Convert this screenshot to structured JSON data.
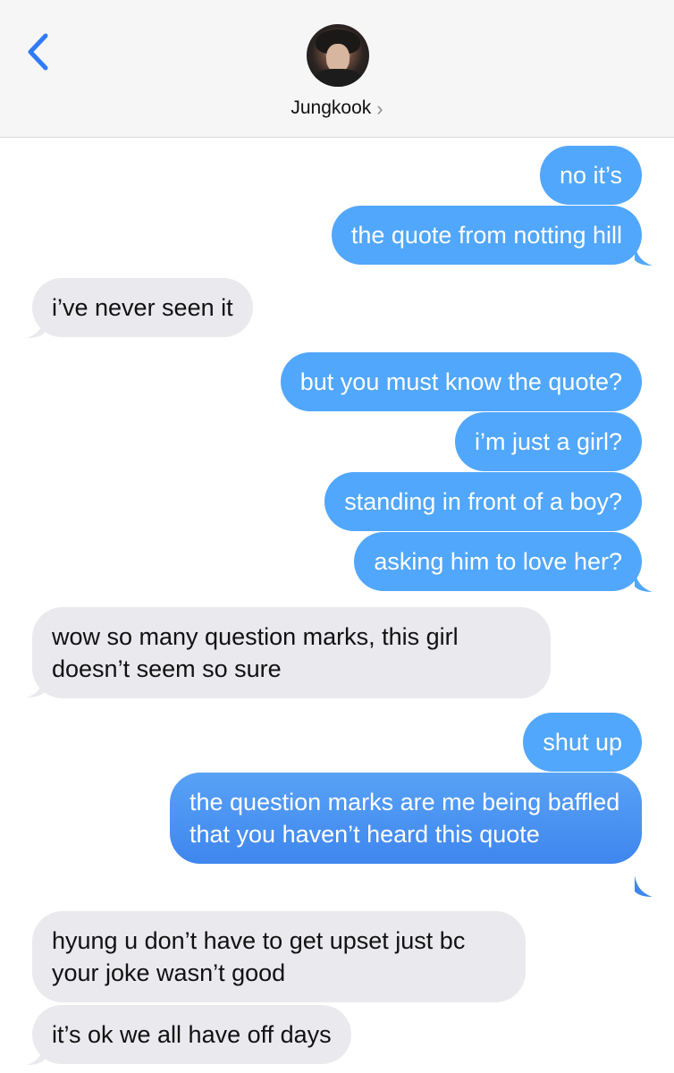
{
  "header": {
    "contact_name": "Jungkook",
    "back_icon": "chevron-left-icon",
    "contact_chevron": "›",
    "avatar": "contact-photo"
  },
  "colors": {
    "outgoing": "#51a7fb",
    "outgoing_dark": "#3f86ee",
    "incoming": "#e9e9ee",
    "accent": "#2f7bf6"
  },
  "messages": [
    {
      "from": "me",
      "text": "no it’s"
    },
    {
      "from": "me",
      "text": "the quote from notting hill"
    },
    {
      "from": "them",
      "text": "i’ve never seen it"
    },
    {
      "from": "me",
      "text": "but you must know the quote?"
    },
    {
      "from": "me",
      "text": "i’m just a girl?"
    },
    {
      "from": "me",
      "text": "standing in front of a boy?"
    },
    {
      "from": "me",
      "text": "asking him to love her?"
    },
    {
      "from": "them",
      "text": "wow so many question marks, this girl doesn’t seem so sure"
    },
    {
      "from": "me",
      "text": "shut up"
    },
    {
      "from": "me",
      "text": "the question marks are me being baffled that you haven’t heard this quote"
    },
    {
      "from": "them",
      "text": "hyung u don’t have to get upset just bc your joke wasn’t good"
    },
    {
      "from": "them",
      "text": "it’s ok we all have off days"
    }
  ]
}
